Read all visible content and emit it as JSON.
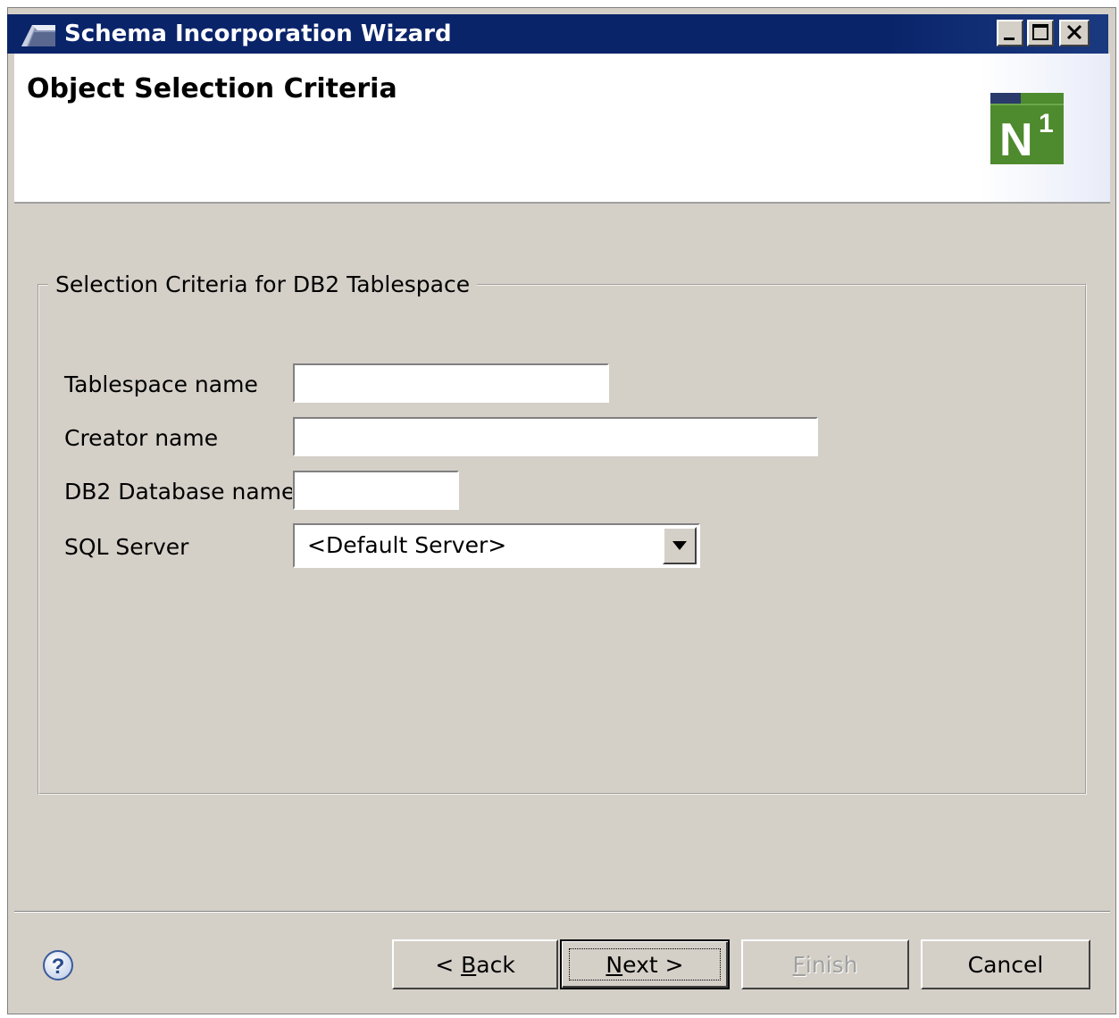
{
  "window": {
    "title": "Schema Incorporation Wizard"
  },
  "banner": {
    "title": "Object Selection Criteria",
    "logo_letter": "N",
    "logo_superscript": "1",
    "logo_colors": {
      "green": "#4e8a2e",
      "navy": "#2a3a6a"
    }
  },
  "group": {
    "legend": "Selection Criteria for DB2 Tablespace",
    "fields": [
      {
        "label": "Tablespace name",
        "value": ""
      },
      {
        "label": "Creator name",
        "value": ""
      },
      {
        "label": "DB2 Database name",
        "value": ""
      }
    ],
    "sql_server": {
      "label": "SQL Server",
      "selected": "<Default Server>"
    }
  },
  "buttons": {
    "back_prefix": "< ",
    "back_mnemonic": "B",
    "back_rest": "ack",
    "next_mnemonic": "N",
    "next_rest": "ext >",
    "finish_mnemonic": "F",
    "finish_rest": "inish",
    "cancel": "Cancel",
    "finish_enabled": false
  },
  "icons": {
    "help": "help-icon",
    "title": "wizard-icon"
  },
  "colors": {
    "titlebar": "#0a246a",
    "dialog_bg": "#d4d0c8"
  }
}
